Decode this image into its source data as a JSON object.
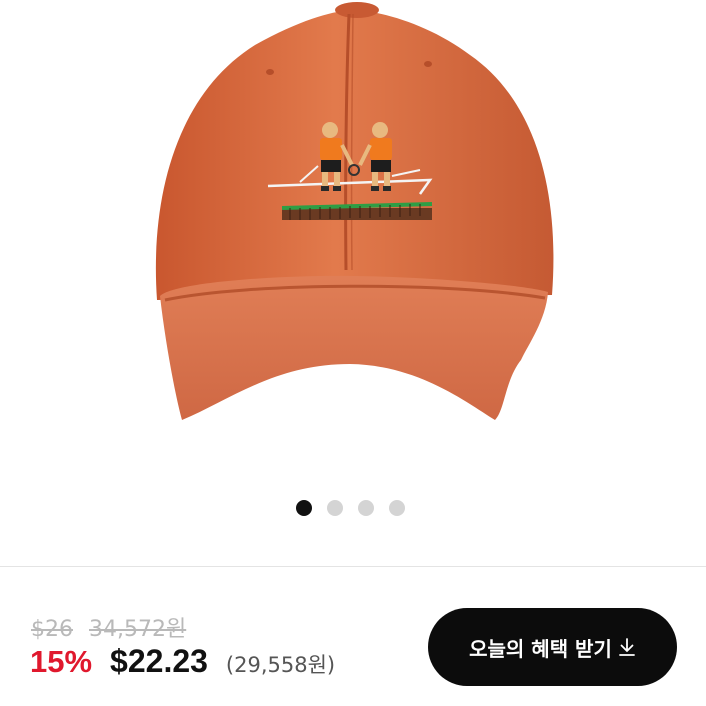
{
  "gallery": {
    "image_alt": "orange baseball cap with embroidered tennis players",
    "dot_count": 4,
    "active_index": 0
  },
  "pricing": {
    "original_usd": "$26",
    "original_krw": "34,572원",
    "discount": "15%",
    "sale_usd": "$22.23",
    "sale_krw": "(29,558원)"
  },
  "cta": {
    "label": "오늘의 혜택 받기",
    "icon": "download-arrow-icon"
  },
  "colors": {
    "discount_red": "#e0182d",
    "button_black": "#0c0c0c",
    "cap_orange": "#d8683f"
  }
}
